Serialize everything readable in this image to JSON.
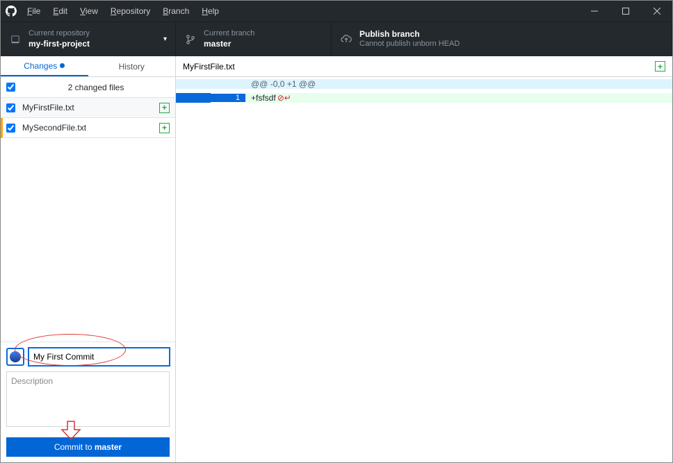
{
  "menu": {
    "file": "File",
    "edit": "Edit",
    "view": "View",
    "repository": "Repository",
    "branch": "Branch",
    "help": "Help"
  },
  "toolbar": {
    "repo_label": "Current repository",
    "repo_value": "my-first-project",
    "branch_label": "Current branch",
    "branch_value": "master",
    "publish_label": "Publish branch",
    "publish_value": "Cannot publish unborn HEAD"
  },
  "tabs": {
    "changes": "Changes",
    "history": "History"
  },
  "changes_header": "2 changed files",
  "files": [
    {
      "name": "MyFirstFile.txt",
      "selected": true
    },
    {
      "name": "MySecondFile.txt",
      "selected": false
    }
  ],
  "commit": {
    "summary": "My First Commit",
    "desc_placeholder": "Description",
    "button_prefix": "Commit to ",
    "button_branch": "master"
  },
  "diff": {
    "filename": "MyFirstFile.txt",
    "hunk": "@@ -0,0 +1 @@",
    "line_no": "1",
    "added": "+fsfsdf"
  }
}
